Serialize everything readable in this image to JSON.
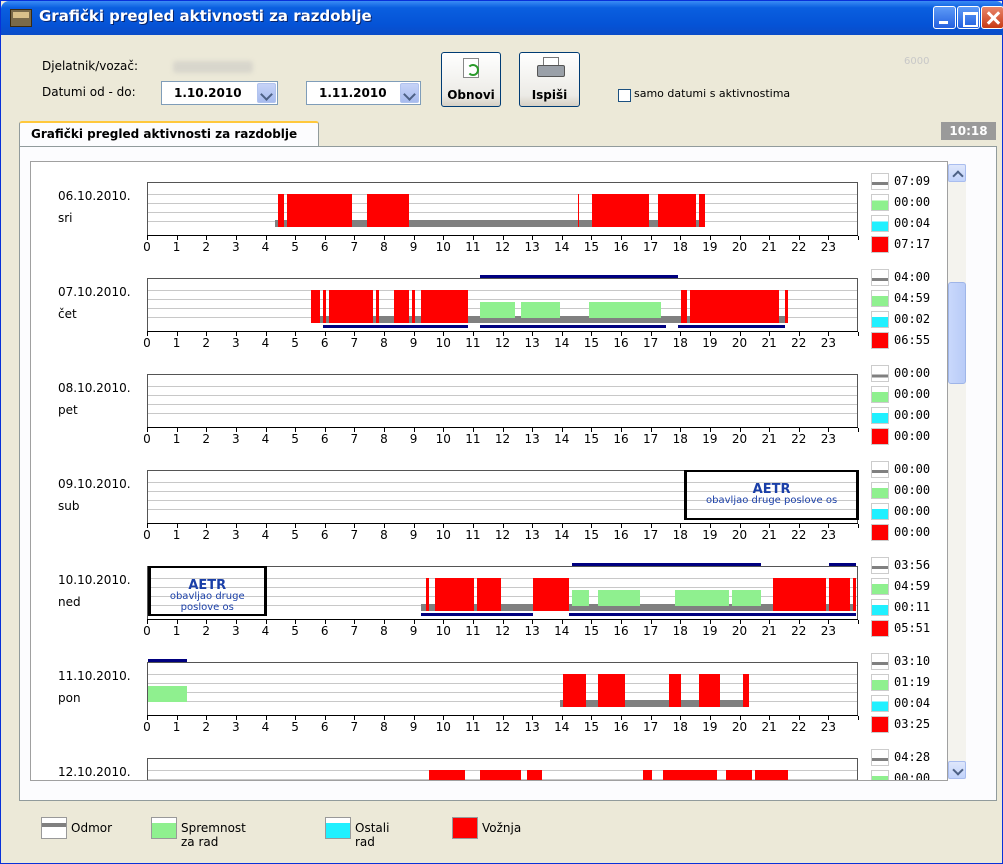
{
  "window": {
    "title": "Grafički pregled aktivnosti za razdoblje"
  },
  "header": {
    "driver_label": "Djelatnik/vozač:",
    "dates_label": "Datumi od - do:",
    "date_from": "1.10.2010",
    "date_to": "1.11.2010",
    "refresh_label": "Obnovi",
    "print_label": "Ispiši",
    "only_active_label": "samo datumi s aktivnostima",
    "only_active_checked": false,
    "faint_code": "6000"
  },
  "tab": {
    "label": "Grafički pregled aktivnosti za razdoblje",
    "time": "10:18"
  },
  "colors": {
    "odmor": "#808080",
    "spremnost": "#8ff08f",
    "ostali": "#20f0ff",
    "voznja": "#ff0000",
    "line": "#00007f"
  },
  "hours": [
    "0",
    "1",
    "2",
    "3",
    "4",
    "5",
    "6",
    "7",
    "8",
    "9",
    "10",
    "11",
    "12",
    "13",
    "14",
    "15",
    "16",
    "17",
    "18",
    "19",
    "20",
    "21",
    "22",
    "23"
  ],
  "days": [
    {
      "date": "06.10.2010.",
      "day": "sri",
      "totals": [
        "07:09",
        "00:00",
        "00:04",
        "07:17"
      ],
      "voznja": [
        [
          4.4,
          4.6
        ],
        [
          4.7,
          5.0
        ],
        [
          5.0,
          6.9
        ],
        [
          7.4,
          8.8
        ],
        [
          14.5,
          14.55
        ],
        [
          15.0,
          16.9
        ],
        [
          17.2,
          18.5
        ],
        [
          18.6,
          18.8
        ]
      ],
      "odmor": [
        [
          4.3,
          18.8
        ]
      ],
      "lines_top": [],
      "lines_bottom": []
    },
    {
      "date": "07.10.2010.",
      "day": "čet",
      "totals": [
        "04:00",
        "04:59",
        "00:02",
        "06:55"
      ],
      "voznja": [
        [
          5.5,
          5.8
        ],
        [
          5.9,
          6.0
        ],
        [
          6.1,
          7.6
        ],
        [
          7.7,
          7.8
        ],
        [
          8.3,
          8.8
        ],
        [
          8.9,
          9.0
        ],
        [
          9.2,
          10.8
        ],
        [
          18.0,
          18.2
        ],
        [
          18.3,
          21.3
        ],
        [
          21.5,
          21.6
        ]
      ],
      "spremnost": [
        [
          11.2,
          12.4
        ],
        [
          12.6,
          13.9
        ],
        [
          14.9,
          17.3
        ]
      ],
      "odmor": [
        [
          5.5,
          21.6
        ]
      ],
      "lines_top": [
        [
          11.2,
          17.9
        ]
      ],
      "lines_bottom": [
        [
          5.9,
          10.8
        ],
        [
          11.2,
          17.5
        ],
        [
          17.9,
          21.5
        ]
      ]
    },
    {
      "date": "08.10.2010.",
      "day": "pet",
      "totals": [
        "00:00",
        "00:00",
        "00:00",
        "00:00"
      ],
      "lines_top": [],
      "lines_bottom": []
    },
    {
      "date": "09.10.2010.",
      "day": "sub",
      "totals": [
        "00:00",
        "00:00",
        "00:00",
        "00:00"
      ],
      "aetr": {
        "from": 18.1,
        "to": 24.0,
        "title": "AETR",
        "text": "obavljao druge poslove os"
      },
      "lines_top": [],
      "lines_bottom": []
    },
    {
      "date": "10.10.2010.",
      "day": "ned",
      "totals": [
        "03:56",
        "04:59",
        "00:11",
        "05:51"
      ],
      "aetr": {
        "from": 0.0,
        "to": 4.0,
        "title": "AETR",
        "text": "obavljao druge poslove os"
      },
      "voznja": [
        [
          9.4,
          9.5
        ],
        [
          9.7,
          11.0
        ],
        [
          11.1,
          11.9
        ],
        [
          13.0,
          14.2
        ],
        [
          21.1,
          22.9
        ],
        [
          23.0,
          23.7
        ],
        [
          23.8,
          23.9
        ]
      ],
      "spremnost": [
        [
          14.3,
          14.9
        ],
        [
          15.2,
          16.6
        ],
        [
          17.8,
          19.6
        ],
        [
          19.7,
          20.7
        ]
      ],
      "odmor": [
        [
          9.2,
          23.9
        ]
      ],
      "lines_top": [
        [
          14.3,
          20.7
        ],
        [
          23.0,
          23.9
        ]
      ],
      "lines_bottom": [
        [
          9.2,
          13.0
        ],
        [
          14.2,
          23.9
        ]
      ]
    },
    {
      "date": "11.10.2010.",
      "day": "pon",
      "totals": [
        "03:10",
        "01:19",
        "00:04",
        "03:25"
      ],
      "voznja": [
        [
          14.0,
          14.8
        ],
        [
          15.2,
          16.1
        ],
        [
          17.6,
          18.0
        ],
        [
          18.6,
          19.3
        ],
        [
          20.1,
          20.3
        ]
      ],
      "spremnost": [
        [
          0.0,
          1.3
        ]
      ],
      "odmor": [
        [
          13.9,
          20.3
        ]
      ],
      "lines_top": [
        [
          0.0,
          1.3
        ]
      ],
      "lines_bottom": []
    },
    {
      "date": "12.10.2010.",
      "day": "",
      "totals": [
        "04:28",
        "00:00",
        "",
        ""
      ],
      "voznja": [
        [
          9.5,
          10.7
        ],
        [
          11.2,
          12.6
        ],
        [
          12.8,
          13.3
        ],
        [
          16.7,
          17.0
        ],
        [
          17.4,
          19.2
        ],
        [
          19.5,
          20.4
        ],
        [
          20.5,
          21.6
        ]
      ],
      "lines_top": [],
      "lines_bottom": []
    }
  ],
  "legend": [
    {
      "label": "Odmor",
      "color": "#808080"
    },
    {
      "label": "Spremnost za rad",
      "color": "#8ff08f"
    },
    {
      "label": "Ostali rad",
      "color": "#20f0ff"
    },
    {
      "label": "Vožnja",
      "color": "#ff0000"
    }
  ]
}
